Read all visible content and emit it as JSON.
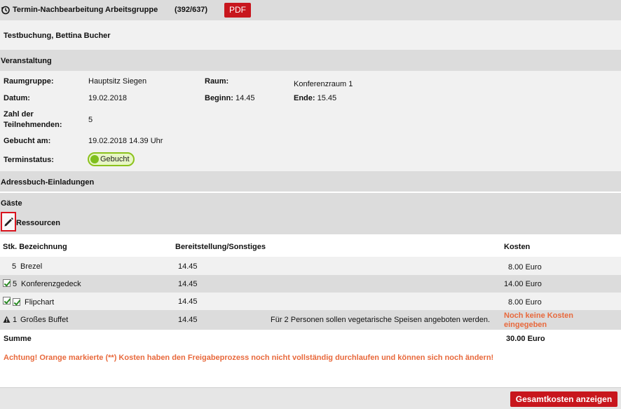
{
  "header": {
    "title": "Termin-Nachbearbeitung Arbeitsgruppe",
    "counter": "(392/637)",
    "pdf_label": "PDF"
  },
  "booking_name": "Testbuchung, Bettina Bucher",
  "sections": {
    "veranstaltung": "Veranstaltung",
    "adressbuch": "Adressbuch-Einladungen",
    "gaeste": "Gäste",
    "ressourcen": "Ressourcen"
  },
  "event": {
    "raumgruppe_label": "Raumgruppe:",
    "raumgruppe_value": "Hauptsitz Siegen",
    "raum_label": "Raum:",
    "raum_value": "Konferenzraum 1",
    "datum_label": "Datum:",
    "datum_value": "19.02.2018",
    "beginn_label": "Beginn:",
    "beginn_value": "14.45",
    "ende_label": "Ende:",
    "ende_value": "15.45",
    "teilnehmer_label_1": "Zahl der",
    "teilnehmer_label_2": "Teilnehmenden:",
    "teilnehmer_value": "5",
    "gebucht_label": "Gebucht am:",
    "gebucht_value": "19.02.2018 14.39 Uhr",
    "status_label": "Terminstatus:",
    "status_value": "Gebucht"
  },
  "resources": {
    "headers": {
      "stk_bezeichnung": "Stk. Bezeichnung",
      "bereitstellung": "Bereitstellung/Sonstiges",
      "kosten": "Kosten"
    },
    "rows": [
      {
        "stk": "5",
        "name": "Brezel",
        "zeit": "14.45",
        "sonstiges": "",
        "kosten": "8.00 Euro"
      },
      {
        "stk": "5",
        "name": "Konferenzgedeck",
        "zeit": "14.45",
        "sonstiges": "",
        "kosten": "14.00 Euro"
      },
      {
        "stk": "",
        "name": "Flipchart",
        "zeit": "14.45",
        "sonstiges": "",
        "kosten": "8.00 Euro"
      },
      {
        "stk": "1",
        "name": "Großes Buffet",
        "zeit": "14.45",
        "sonstiges": "Für 2 Personen sollen vegetarische Speisen angeboten werden.",
        "kosten_1": "Noch keine Kosten",
        "kosten_2": "eingegeben"
      }
    ],
    "summe_label": "Summe",
    "summe_value": "30.00 Euro"
  },
  "warning_text": "Achtung! Orange markierte (**) Kosten haben den Freigabeprozess noch nicht vollständig durchlaufen und können sich noch ändern!",
  "footer": {
    "total_button": "Gesamtkosten anzeigen"
  },
  "colors": {
    "accent_red": "#c8161d",
    "status_green": "#8cc21d",
    "warning_orange": "#e8693c"
  },
  "icons": {
    "header": "history-icon",
    "edit": "pencil-icon",
    "check": "checkbox-checked-icon",
    "warning": "warning-triangle-icon"
  }
}
